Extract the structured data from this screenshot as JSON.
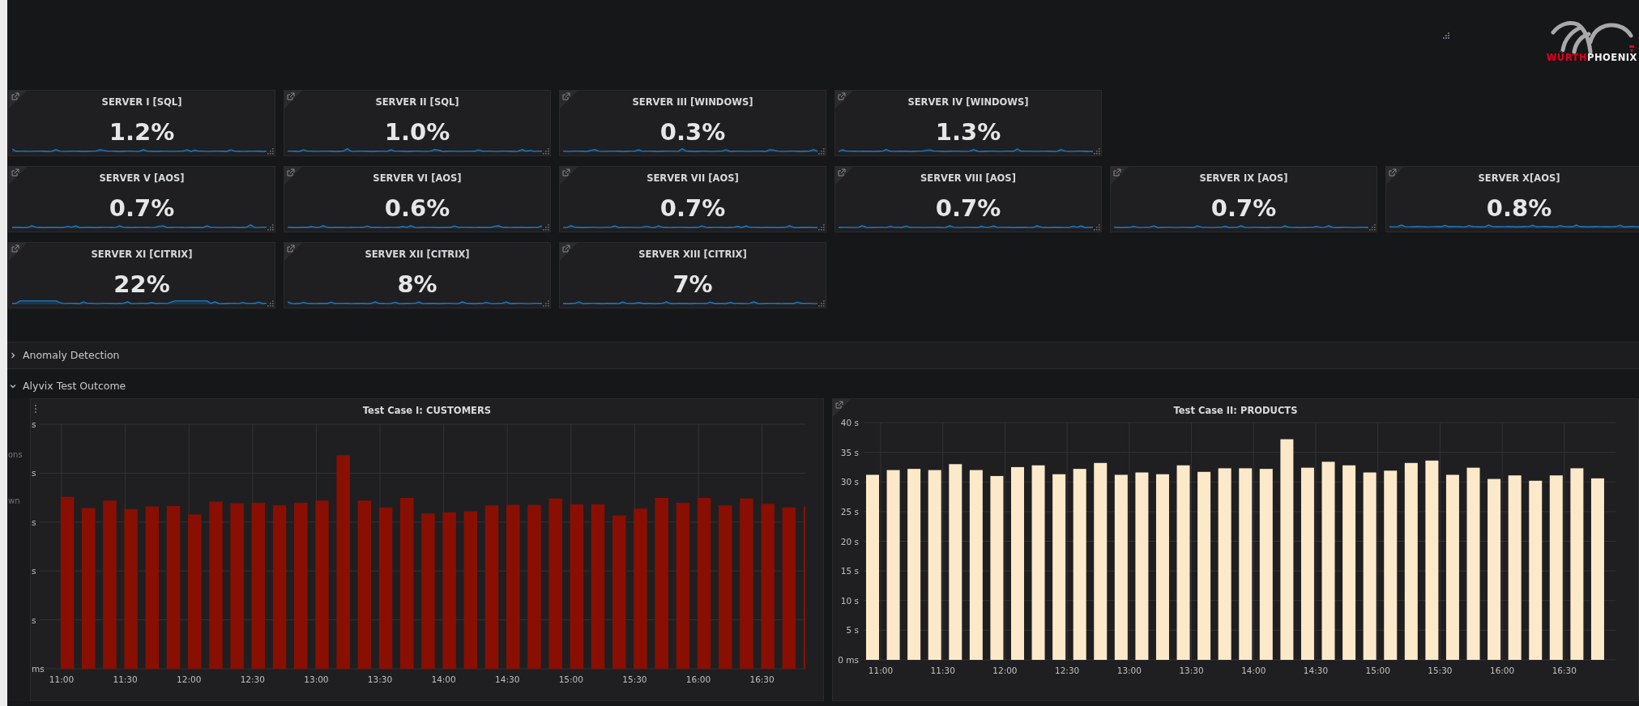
{
  "logo": {
    "text_red": "WÜRTH",
    "text_white": "PHOENIX"
  },
  "stat_rows": [
    {
      "panels": [
        {
          "title": "SERVER I [SQL]",
          "value": "1.2%"
        },
        {
          "title": "SERVER II [SQL]",
          "value": "1.0%"
        },
        {
          "title": "SERVER III [WINDOWS]",
          "value": "0.3%"
        },
        {
          "title": "SERVER IV [WINDOWS]",
          "value": "1.3%"
        }
      ]
    },
    {
      "panels": [
        {
          "title": "SERVER V [AOS]",
          "value": "0.7%"
        },
        {
          "title": "SERVER VI [AOS]",
          "value": "0.6%"
        },
        {
          "title": "SERVER VII [AOS]",
          "value": "0.7%"
        },
        {
          "title": "SERVER VIII [AOS]",
          "value": "0.7%"
        },
        {
          "title": "SERVER IX [AOS]",
          "value": "0.7%"
        },
        {
          "title": "SERVER X[AOS]",
          "value": "0.8%"
        }
      ]
    },
    {
      "panels": [
        {
          "title": "SERVER XI [CITRIX]",
          "value": "22%"
        },
        {
          "title": "SERVER XII [CITRIX]",
          "value": "8%"
        },
        {
          "title": "SERVER XIII [CITRIX]",
          "value": "7%"
        }
      ]
    }
  ],
  "rows": [
    {
      "title": "Anomaly Detection",
      "expanded": false
    },
    {
      "title": "Alyvix Test Outcome",
      "expanded": true
    }
  ],
  "left_chart": {
    "title": "Test Case I: CUSTOMERS",
    "legend_fragments": [
      "ons",
      "wn"
    ],
    "y_label_fragments": [
      "s",
      "s",
      "s",
      "s",
      "s",
      "ms"
    ],
    "x_labels": [
      "11:00",
      "11:30",
      "12:00",
      "12:30",
      "13:00",
      "13:30",
      "14:00",
      "14:30",
      "15:00",
      "15:30",
      "16:00",
      "16:30"
    ]
  },
  "right_chart": {
    "title": "Test Case II: PRODUCTS",
    "chart_data": {
      "type": "bar",
      "categories": [
        "11:00",
        null,
        null,
        "11:30",
        null,
        null,
        "12:00",
        null,
        null,
        "12:30",
        null,
        null,
        "13:00",
        null,
        null,
        "13:30",
        null,
        null,
        "14:00",
        null,
        null,
        "14:30",
        null,
        null,
        "15:00",
        null,
        null,
        "15:30",
        null,
        null,
        "16:00",
        null,
        null,
        "16:30",
        null,
        null
      ],
      "ylim": [
        0,
        40
      ],
      "grid": true,
      "yticks": [
        {
          "value": 0,
          "label": "0 ms"
        },
        {
          "value": 5,
          "label": "5 s"
        },
        {
          "value": 10,
          "label": "10 s"
        },
        {
          "value": 15,
          "label": "15 s"
        },
        {
          "value": 20,
          "label": "20 s"
        },
        {
          "value": 25,
          "label": "25 s"
        },
        {
          "value": 30,
          "label": "30 s"
        },
        {
          "value": 35,
          "label": "35 s"
        },
        {
          "value": 40,
          "label": "40 s"
        }
      ],
      "series": [
        {
          "color": "#fbe9c9",
          "values": [
            31.2,
            32,
            32.2,
            32,
            33,
            32,
            31,
            32.5,
            32.8,
            31.3,
            32.2,
            33.2,
            31.2,
            31.6,
            31.3,
            32.8,
            31.7,
            32.3,
            32.3,
            32.2,
            37.2,
            32.4,
            33.4,
            32.8,
            31.6,
            31.9,
            33.2,
            33.6,
            31.2,
            32.4,
            30.5,
            31.1,
            30.2,
            31.1,
            32.3,
            30.6
          ]
        }
      ]
    }
  }
}
